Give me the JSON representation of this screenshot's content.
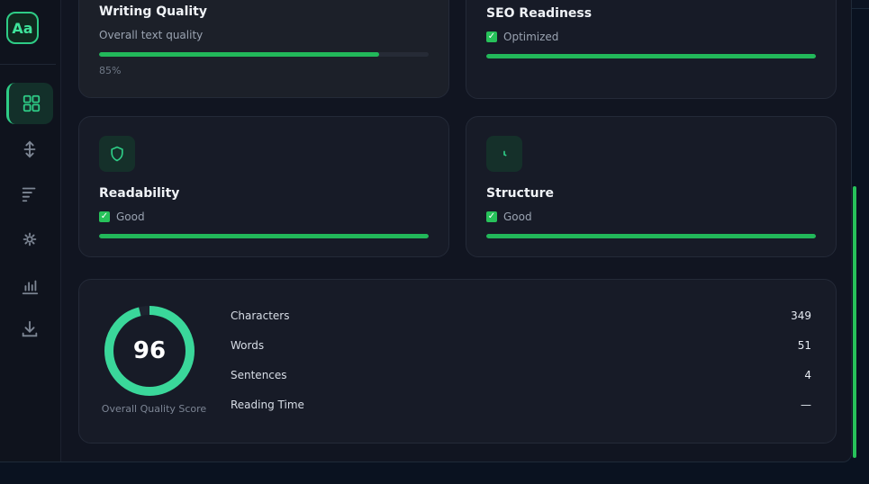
{
  "app": {
    "logo_text": "Aa"
  },
  "sidebar": {
    "items": [
      {
        "name": "dashboard",
        "icon": "grid-icon",
        "active": true
      },
      {
        "name": "resize",
        "icon": "vertical-arrows-icon",
        "active": false
      },
      {
        "name": "sort",
        "icon": "sort-lines-icon",
        "active": false
      },
      {
        "name": "settings",
        "icon": "sun-gear-icon",
        "active": false
      },
      {
        "name": "stats",
        "icon": "bar-chart-icon",
        "active": false
      },
      {
        "name": "download",
        "icon": "download-icon",
        "active": false
      }
    ]
  },
  "cards": {
    "writing_quality": {
      "title": "Writing Quality",
      "subtitle": "Overall text quality",
      "progress": 0.85,
      "percent_text": "85%"
    },
    "seo_readiness": {
      "title": "SEO Readiness",
      "status": "Optimized",
      "progress": 1.0
    },
    "readability": {
      "title": "Readability",
      "status": "Good",
      "progress": 1.0,
      "icon": "shield-icon"
    },
    "structure": {
      "title": "Structure",
      "status": "Good",
      "progress": 1.0,
      "icon": "clock-icon"
    }
  },
  "summary": {
    "score": "96",
    "score_value": 96,
    "score_label": "Overall Quality Score",
    "stats": [
      {
        "label": "Characters",
        "value": "349"
      },
      {
        "label": "Words",
        "value": "51"
      },
      {
        "label": "Sentences",
        "value": "4"
      },
      {
        "label": "Reading Time",
        "value": "—"
      }
    ]
  },
  "colors": {
    "accent": "#2ecc86",
    "progress": "#22b85a",
    "check": "#27c25a",
    "ring": "#3ad79a"
  }
}
